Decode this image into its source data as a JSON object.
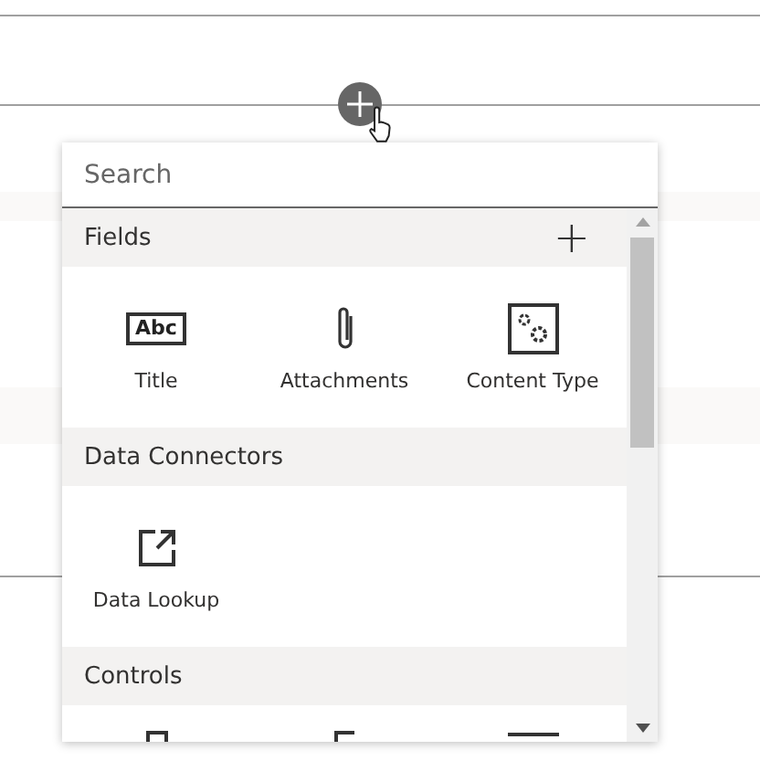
{
  "search": {
    "placeholder": "Search"
  },
  "sections": [
    {
      "title": "Fields",
      "add_button": "+",
      "items": [
        {
          "label": "Title",
          "kind": "text",
          "icon_text": "Abc"
        },
        {
          "label": "Attachments",
          "kind": "paperclip"
        },
        {
          "label": "Content Type",
          "kind": "gears"
        }
      ]
    },
    {
      "title": "Data Connectors",
      "items": [
        {
          "label": "Data Lookup",
          "kind": "link"
        }
      ]
    },
    {
      "title": "Controls"
    }
  ]
}
